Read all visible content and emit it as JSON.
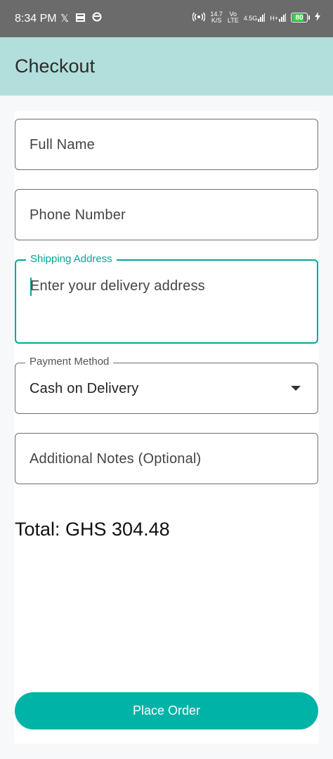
{
  "status_bar": {
    "time": "8:34 PM",
    "left_icons": [
      "x-icon",
      "message-icon",
      "circle-icon"
    ],
    "net_speed_top": "14.7",
    "net_speed_bottom": "K/S",
    "volte_top": "Vo",
    "volte_bottom": "LTE",
    "signal1_label": "4.5G",
    "signal2_label": "H+",
    "battery": "80",
    "battery_level": 0.8,
    "battery_color": "#3ccf4e"
  },
  "app_bar": {
    "title": "Checkout",
    "color": "#b2dfdb"
  },
  "form": {
    "full_name_placeholder": "Full Name",
    "phone_placeholder": "Phone Number",
    "address_label": "Shipping Address",
    "address_placeholder": "Enter your delivery address",
    "payment_label": "Payment Method",
    "payment_value": "Cash on Delivery",
    "notes_placeholder": "Additional Notes (Optional)"
  },
  "total": "Total: GHS 304.48",
  "actions": {
    "place_order": "Place Order",
    "accent_color": "#00b3a7"
  }
}
